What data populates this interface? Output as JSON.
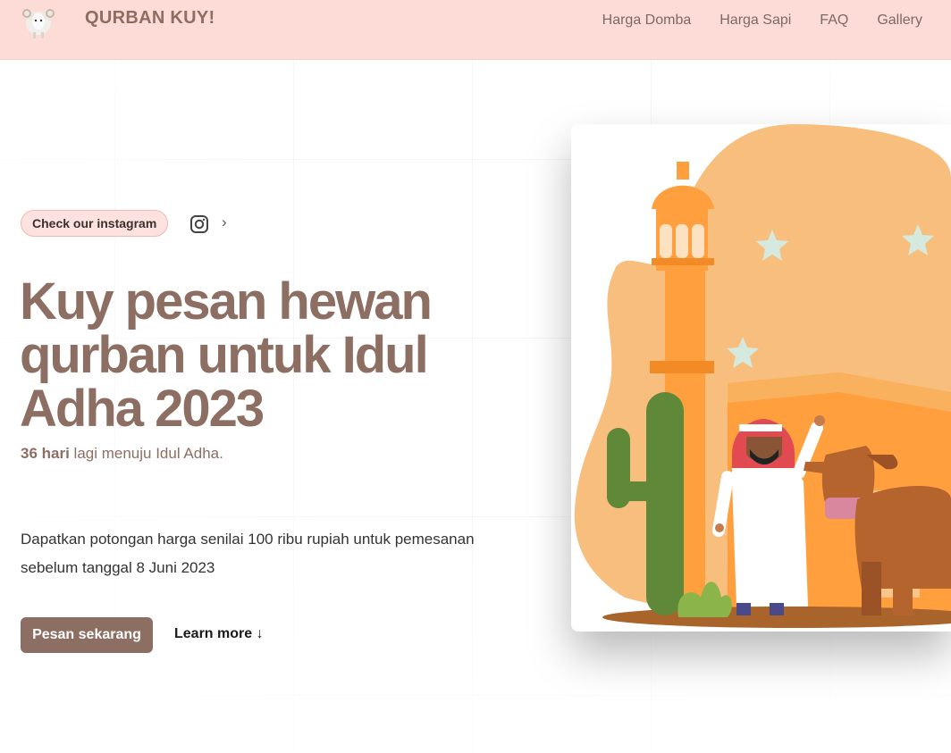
{
  "header": {
    "brand": "QURBAN KUY!",
    "logo_icon": "sheep-icon",
    "nav": [
      {
        "label": "Harga Domba"
      },
      {
        "label": "Harga Sapi"
      },
      {
        "label": "FAQ"
      },
      {
        "label": "Gallery"
      }
    ]
  },
  "hero": {
    "instagram_pill": "Check our instagram",
    "instagram_icon": "instagram-icon",
    "chevron": "›",
    "title": "Kuy pesan hewan qurban untuk Idul Adha 2023",
    "countdown_bold": "36 hari",
    "countdown_rest": " lagi menuju Idul Adha.",
    "description": "Dapatkan potongan harga senilai 100 ribu rupiah untuk pemesanan sebelum tanggal 8 Juni 2023",
    "cta": "Pesan sekarang",
    "learn_more": "Learn more ↓",
    "illustration_icon": "mosque-cow-illustration"
  },
  "colors": {
    "header_bg": "#fddbd7",
    "brand": "#8d6e63",
    "pill_bg": "#fde2df",
    "illustration_orange": "#ff9f3e",
    "illustration_peach": "#f8be7e"
  }
}
